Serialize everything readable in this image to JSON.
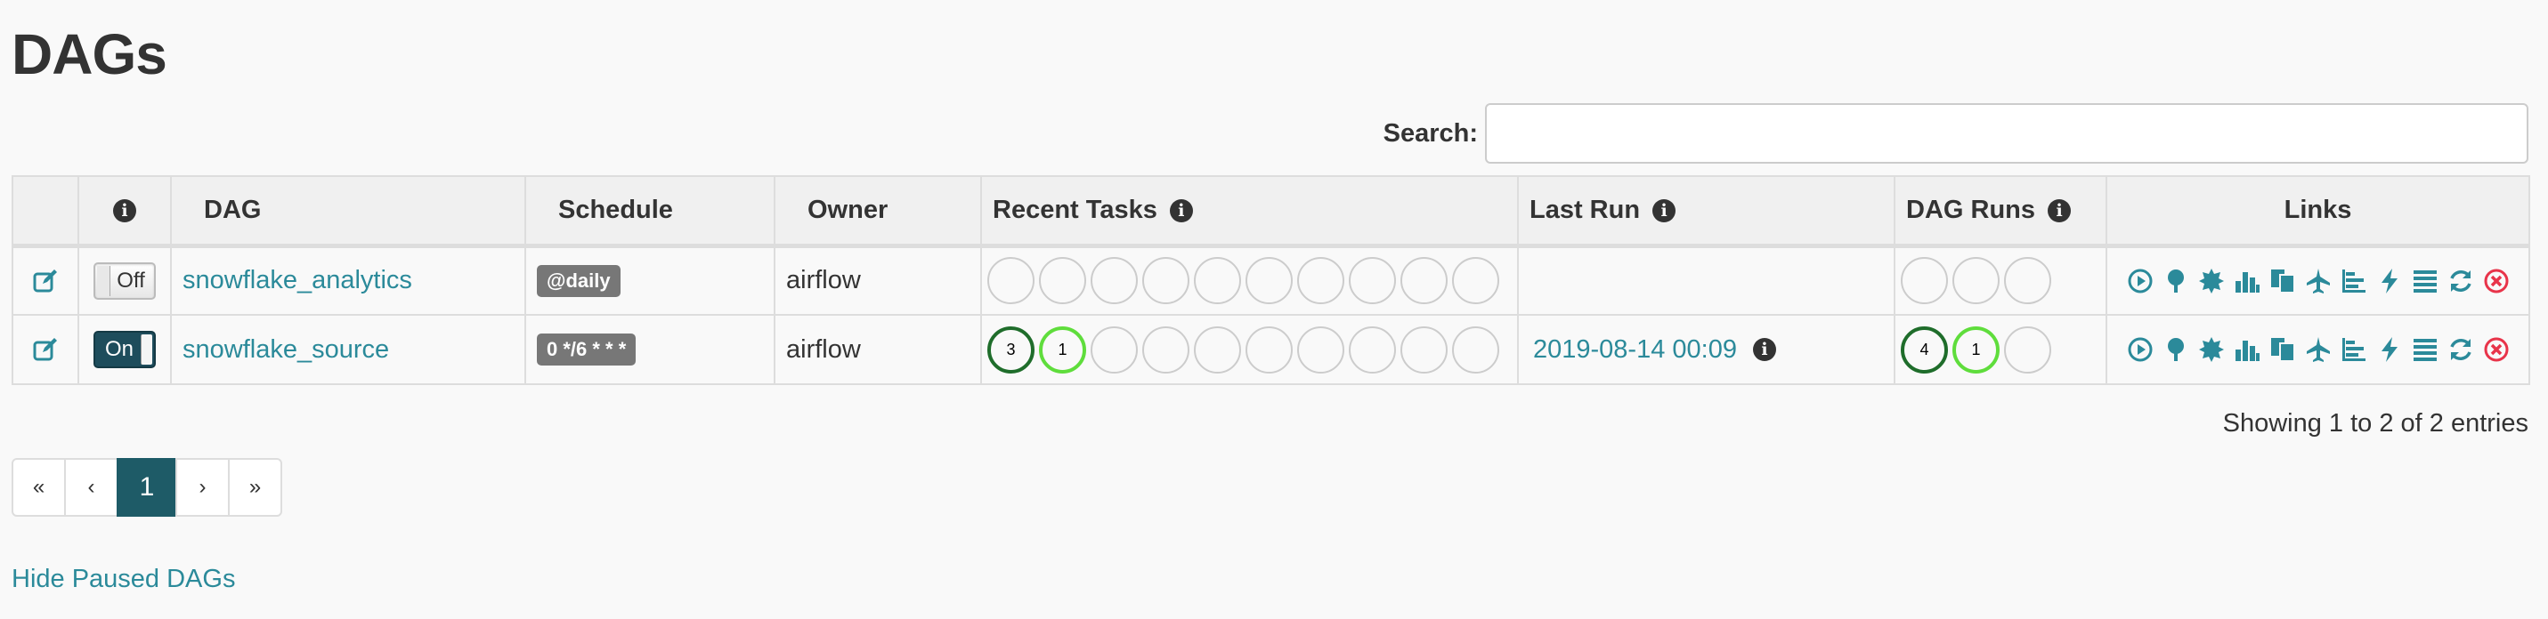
{
  "page": {
    "title": "DAGs"
  },
  "search": {
    "label": "Search:",
    "value": "",
    "placeholder": ""
  },
  "table": {
    "headers": {
      "info": "i",
      "dag": "DAG",
      "schedule": "Schedule",
      "owner": "Owner",
      "recent_tasks": "Recent Tasks",
      "last_run": "Last Run",
      "dag_runs": "DAG Runs",
      "links": "Links"
    },
    "rows": [
      {
        "toggle": "Off",
        "dag_id": "snowflake_analytics",
        "schedule": "@daily",
        "owner": "airflow",
        "recent_tasks": [
          "",
          "",
          "",
          "",
          "",
          "",
          "",
          "",
          "",
          ""
        ],
        "last_run": "",
        "dag_runs": [
          "",
          "",
          ""
        ]
      },
      {
        "toggle": "On",
        "dag_id": "snowflake_source",
        "schedule": "0 */6 * * *",
        "owner": "airflow",
        "recent_tasks": [
          "3",
          "1",
          "",
          "",
          "",
          "",
          "",
          "",
          "",
          ""
        ],
        "last_run": "2019-08-14 00:09",
        "dag_runs": [
          "4",
          "1",
          ""
        ]
      }
    ],
    "link_icons": [
      "trigger-dag-icon",
      "tree-view-icon",
      "graph-view-icon",
      "task-duration-icon",
      "task-tries-icon",
      "landing-times-icon",
      "gantt-icon",
      "code-view-icon",
      "logs-icon",
      "refresh-icon",
      "delete-icon"
    ]
  },
  "entries_text": "Showing 1 to 2 of 2 entries",
  "pagination": {
    "first": "«",
    "prev": "‹",
    "current": "1",
    "next": "›",
    "last": "»"
  },
  "hide_paused_label": "Hide Paused DAGs",
  "colors": {
    "link": "#2b8a9a",
    "success_ring": "#1f6d2b",
    "running_ring": "#5fdd3c",
    "delete": "#e8344a",
    "toggle_on": "#1e4d5c",
    "active_page": "#1e5b67"
  }
}
